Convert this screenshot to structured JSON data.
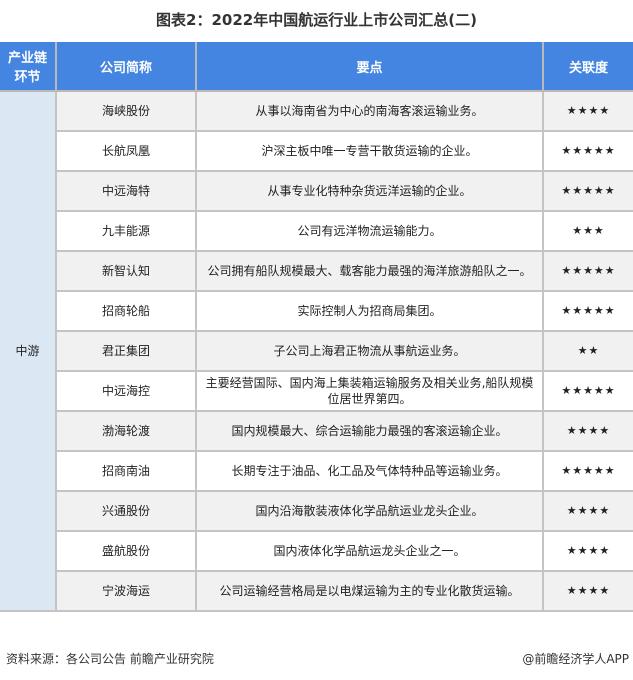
{
  "title": "图表2：2022年中国航运行业上市公司汇总(二)",
  "headers": {
    "segment": "产业链环节",
    "company": "公司简称",
    "point": "要点",
    "relevance": "关联度"
  },
  "segment": "中游",
  "rows": [
    {
      "company": "海峡股份",
      "point": "从事以海南省为中心的南海客滚运输业务。",
      "stars": "★★★★"
    },
    {
      "company": "长航凤凰",
      "point": "沪深主板中唯一专营干散货运输的企业。",
      "stars": "★★★★★"
    },
    {
      "company": "中远海特",
      "point": "从事专业化特种杂货远洋运输的企业。",
      "stars": "★★★★★"
    },
    {
      "company": "九丰能源",
      "point": "公司有远洋物流运输能力。",
      "stars": "★★★"
    },
    {
      "company": "新智认知",
      "point": "公司拥有船队规模最大、载客能力最强的海洋旅游船队之一。",
      "stars": "★★★★★"
    },
    {
      "company": "招商轮船",
      "point": "实际控制人为招商局集团。",
      "stars": "★★★★★"
    },
    {
      "company": "君正集团",
      "point": "子公司上海君正物流从事航运业务。",
      "stars": "★★"
    },
    {
      "company": "中远海控",
      "point": "主要经营国际、国内海上集装箱运输服务及相关业务,船队规模位居世界第四。",
      "stars": "★★★★★"
    },
    {
      "company": "渤海轮渡",
      "point": "国内规模最大、综合运输能力最强的客滚运输企业。",
      "stars": "★★★★"
    },
    {
      "company": "招商南油",
      "point": "长期专注于油品、化工品及气体特种品等运输业务。",
      "stars": "★★★★★"
    },
    {
      "company": "兴通股份",
      "point": "国内沿海散装液体化学品航运业龙头企业。",
      "stars": "★★★★"
    },
    {
      "company": "盛航股份",
      "point": "国内液体化学品航运龙头企业之一。",
      "stars": "★★★★"
    },
    {
      "company": "宁波海运",
      "point": "公司运输经营格局是以电煤运输为主的专业化散货运输。",
      "stars": "★★★★"
    }
  ],
  "footer": {
    "source": "资料来源：各公司公告 前瞻产业研究院",
    "credit": "@前瞻经济学人APP"
  }
}
